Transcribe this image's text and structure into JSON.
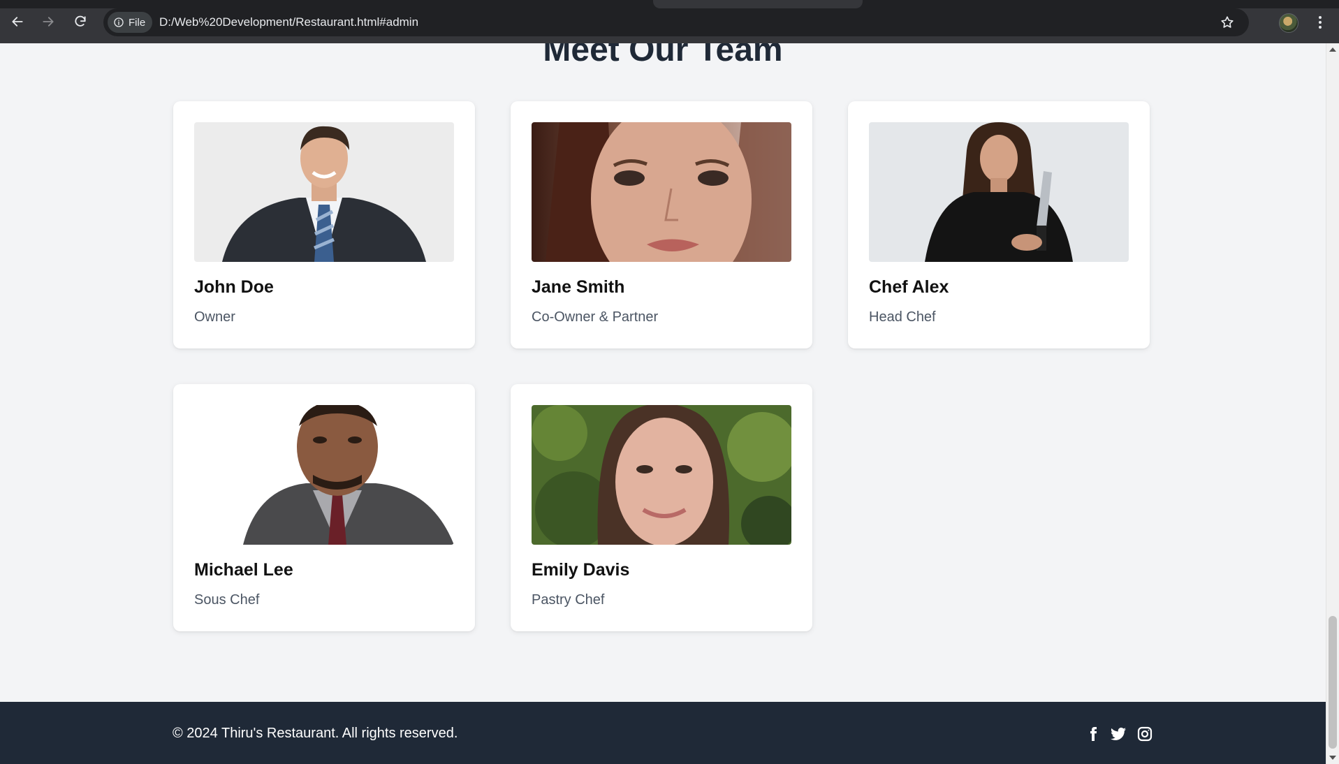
{
  "browser": {
    "chip_label": "File",
    "url": "D:/Web%20Development/Restaurant.html#admin",
    "icons": [
      "back-arrow-icon",
      "forward-arrow-icon",
      "reload-icon",
      "info-icon",
      "star-icon",
      "profile-avatar",
      "more-menu-icon"
    ]
  },
  "page": {
    "section_title": "Meet Our Team",
    "team": [
      {
        "name": "John Doe",
        "role": "Owner"
      },
      {
        "name": "Jane Smith",
        "role": "Co-Owner & Partner"
      },
      {
        "name": "Chef Alex",
        "role": "Head Chef"
      },
      {
        "name": "Michael Lee",
        "role": "Sous Chef"
      },
      {
        "name": "Emily Davis",
        "role": "Pastry Chef"
      }
    ]
  },
  "footer": {
    "copyright": "© 2024 Thiru's Restaurant. All rights reserved.",
    "social": [
      "facebook-icon",
      "twitter-icon",
      "instagram-icon"
    ]
  },
  "colors": {
    "page_bg": "#f3f4f6",
    "footer_bg": "#1f2937",
    "heading": "#1f2937",
    "role_text": "#4b5563"
  }
}
